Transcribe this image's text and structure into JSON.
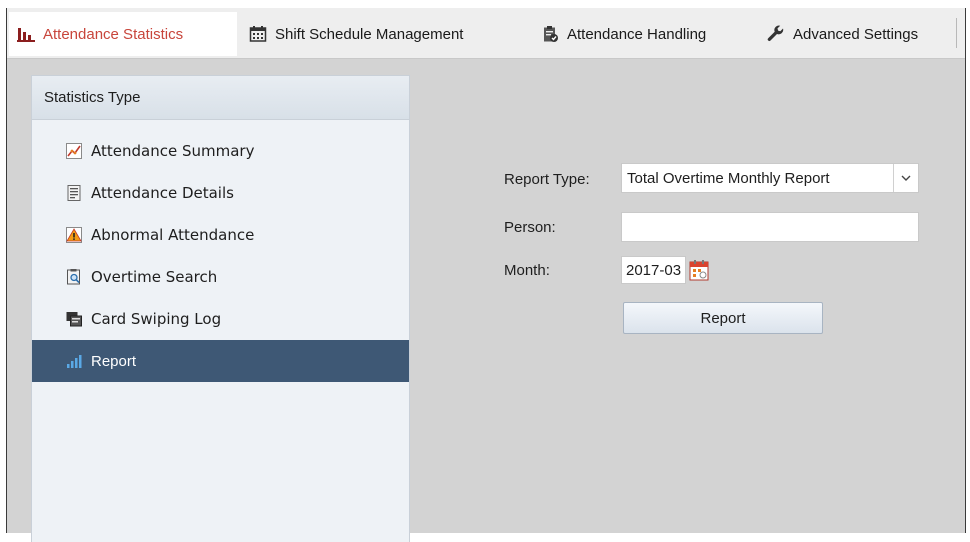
{
  "tabs": [
    {
      "label": "Attendance Statistics",
      "icon": "bar-chart-icon",
      "active": true
    },
    {
      "label": "Shift Schedule Management",
      "icon": "calendar-icon"
    },
    {
      "label": "Attendance Handling",
      "icon": "clipboard-check-icon"
    },
    {
      "label": "Advanced Settings",
      "icon": "wrench-icon"
    }
  ],
  "sidebar": {
    "title": "Statistics Type",
    "items": [
      {
        "label": "Attendance Summary",
        "icon": "summary-chart-icon"
      },
      {
        "label": "Attendance Details",
        "icon": "document-icon"
      },
      {
        "label": "Abnormal Attendance",
        "icon": "warning-icon"
      },
      {
        "label": "Overtime Search",
        "icon": "search-document-icon"
      },
      {
        "label": "Card Swiping Log",
        "icon": "card-log-icon"
      },
      {
        "label": "Report",
        "icon": "signal-bars-icon",
        "selected": true
      }
    ]
  },
  "form": {
    "report_type_label": "Report Type:",
    "report_type_value": "Total Overtime Monthly Report",
    "person_label": "Person:",
    "person_value": "",
    "month_label": "Month:",
    "month_value": "2017-03",
    "report_button": "Report"
  },
  "colors": {
    "active_tab_text": "#c8453b",
    "selected_item_bg": "#3e5875",
    "content_bg": "#d3d3d3"
  }
}
